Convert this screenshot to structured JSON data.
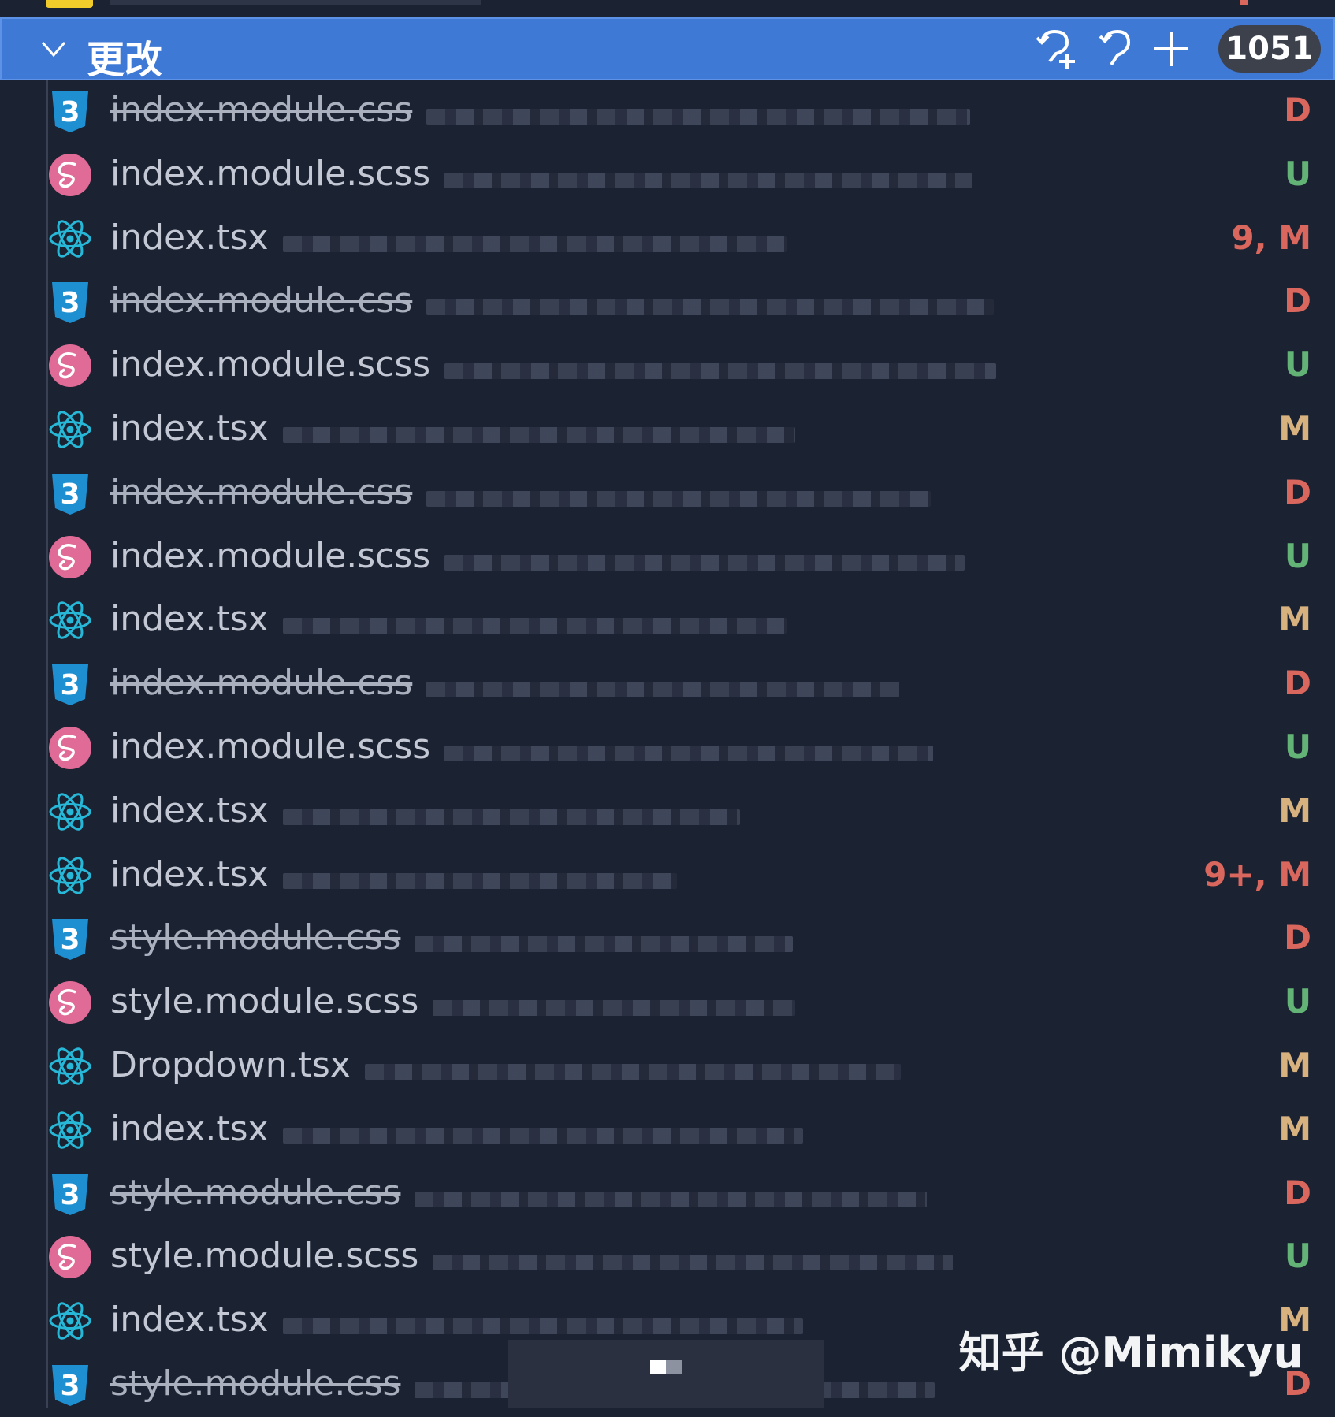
{
  "panel": {
    "section_title": "更改",
    "change_count": "1051",
    "actions": [
      "discard-all-icon",
      "undo-icon",
      "stage-all-icon"
    ]
  },
  "colors": {
    "header_bg": "#3f79d6",
    "panel_bg": "#1b2232",
    "deleted": "#d9675e",
    "untracked": "#63b377",
    "modified": "#d7b27f",
    "css_icon": "#1e8fd0",
    "sass_icon": "#e06b96",
    "react_icon": "#27b8d8"
  },
  "files": [
    {
      "name": "index.module.css",
      "type": "css",
      "status": "D",
      "deleted": true
    },
    {
      "name": "index.module.scss",
      "type": "scss",
      "status": "U",
      "deleted": false
    },
    {
      "name": "index.tsx",
      "type": "tsx",
      "status": "9, M",
      "deleted": false,
      "error": true
    },
    {
      "name": "index.module.css",
      "type": "css",
      "status": "D",
      "deleted": true
    },
    {
      "name": "index.module.scss",
      "type": "scss",
      "status": "U",
      "deleted": false
    },
    {
      "name": "index.tsx",
      "type": "tsx",
      "status": "M",
      "deleted": false
    },
    {
      "name": "index.module.css",
      "type": "css",
      "status": "D",
      "deleted": true
    },
    {
      "name": "index.module.scss",
      "type": "scss",
      "status": "U",
      "deleted": false
    },
    {
      "name": "index.tsx",
      "type": "tsx",
      "status": "M",
      "deleted": false
    },
    {
      "name": "index.module.css",
      "type": "css",
      "status": "D",
      "deleted": true
    },
    {
      "name": "index.module.scss",
      "type": "scss",
      "status": "U",
      "deleted": false
    },
    {
      "name": "index.tsx",
      "type": "tsx",
      "status": "M",
      "deleted": false
    },
    {
      "name": "index.tsx",
      "type": "tsx",
      "status": "9+, M",
      "deleted": false,
      "error": true
    },
    {
      "name": "style.module.css",
      "type": "css",
      "status": "D",
      "deleted": true
    },
    {
      "name": "style.module.scss",
      "type": "scss",
      "status": "U",
      "deleted": false
    },
    {
      "name": "Dropdown.tsx",
      "type": "tsx",
      "status": "M",
      "deleted": false
    },
    {
      "name": "index.tsx",
      "type": "tsx",
      "status": "M",
      "deleted": false
    },
    {
      "name": "style.module.css",
      "type": "css",
      "status": "D",
      "deleted": true
    },
    {
      "name": "style.module.scss",
      "type": "scss",
      "status": "U",
      "deleted": false
    },
    {
      "name": "index.tsx",
      "type": "tsx",
      "status": "M",
      "deleted": false
    },
    {
      "name": "style.module.css",
      "type": "css",
      "status": "D",
      "deleted": true
    }
  ],
  "watermark": "知乎 @Mimikyu"
}
